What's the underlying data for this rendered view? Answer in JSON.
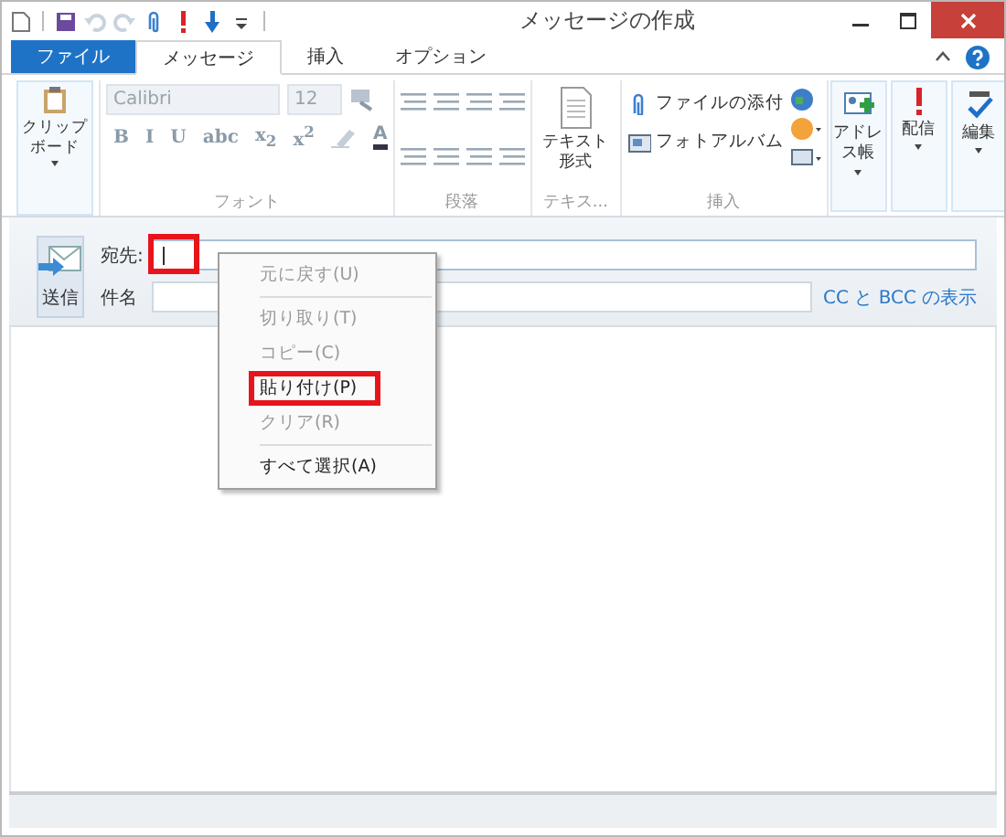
{
  "window": {
    "title": "メッセージの作成"
  },
  "quick_access": [
    {
      "kind": "new",
      "disabled": false
    },
    {
      "kind": "save",
      "disabled": false
    },
    {
      "kind": "undo",
      "disabled": true
    },
    {
      "kind": "redo",
      "disabled": true
    },
    {
      "kind": "attach",
      "disabled": false
    },
    {
      "kind": "priority",
      "disabled": false
    },
    {
      "kind": "low",
      "disabled": false
    },
    {
      "kind": "more",
      "disabled": false
    }
  ],
  "tabs": [
    {
      "label": "ファイル",
      "kind": "file",
      "selected": false
    },
    {
      "label": "メッセージ",
      "kind": "tab",
      "selected": true
    },
    {
      "label": "挿入",
      "kind": "tab",
      "selected": false
    },
    {
      "label": "オプション",
      "kind": "tab",
      "selected": false
    }
  ],
  "ribbon": {
    "groups": [
      {
        "kind": "clipboard",
        "button": "クリップボード",
        "dropdown": true
      },
      {
        "kind": "font",
        "label": "フォント",
        "font_name": "Calibri",
        "font_size": "12",
        "format_buttons": [
          "B",
          "I",
          "U",
          "abc",
          "x$_{2}$",
          "x$^{2}$"
        ],
        "color_button": "A",
        "disabled": true
      },
      {
        "kind": "paragraph",
        "label": "段落"
      },
      {
        "kind": "text",
        "label": "テキス...",
        "button": "テキスト形式"
      },
      {
        "kind": "insert",
        "label": "挿入",
        "buttons": [
          "ファイルの添付",
          "フォトアルバム"
        ]
      },
      {
        "kind": "large",
        "button": "アドレス帳",
        "dropdown": true
      },
      {
        "kind": "large",
        "button": "配信",
        "dropdown": true
      },
      {
        "kind": "large",
        "button": "編集",
        "dropdown": true
      }
    ]
  },
  "compose": {
    "send_button": "送信",
    "to_label": "宛先:",
    "to_highlighted": true,
    "subject_label": "件名",
    "cc_link": "CC と BCC の表示"
  },
  "context_menu": {
    "items": [
      {
        "kind": "item",
        "label": "元に戻す(U)",
        "disabled": true,
        "highlighted": false
      },
      {
        "kind": "separator"
      },
      {
        "kind": "item",
        "label": "切り取り(T)",
        "disabled": true,
        "highlighted": false
      },
      {
        "kind": "item",
        "label": "コピー(C)",
        "disabled": true,
        "highlighted": false
      },
      {
        "kind": "item",
        "label": "貼り付け(P)",
        "disabled": false,
        "highlighted": true
      },
      {
        "kind": "item",
        "label": "クリア(R)",
        "disabled": true,
        "highlighted": false
      },
      {
        "kind": "separator"
      },
      {
        "kind": "item",
        "label": "すべて選択(A)",
        "disabled": false,
        "highlighted": false
      }
    ]
  }
}
